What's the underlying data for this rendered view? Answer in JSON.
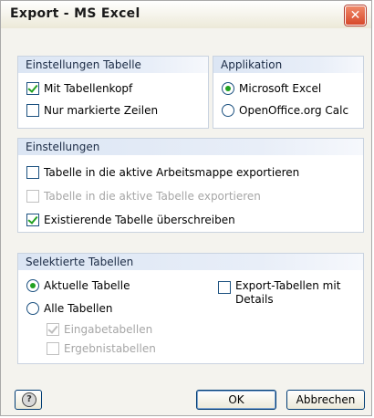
{
  "window": {
    "title": "Export - MS Excel",
    "close_glyph": "✕"
  },
  "settings_table": {
    "header": "Einstellungen Tabelle",
    "with_header": {
      "label": "Mit Tabellenkopf",
      "checked": true
    },
    "selected_rows_only": {
      "label": "Nur markierte Zeilen",
      "checked": false
    }
  },
  "application": {
    "header": "Applikation",
    "options": [
      {
        "label": "Microsoft Excel",
        "selected": true
      },
      {
        "label": "OpenOffice.org Calc",
        "selected": false
      }
    ]
  },
  "settings": {
    "header": "Einstellungen",
    "export_active_workbook": {
      "label": "Tabelle in die aktive Arbeitsmappe exportieren",
      "checked": false,
      "enabled": true
    },
    "export_active_table": {
      "label": "Tabelle in die aktive Tabelle exportieren",
      "checked": false,
      "enabled": false
    },
    "overwrite_existing": {
      "label": "Existierende Tabelle überschreiben",
      "checked": true,
      "enabled": true
    }
  },
  "selected_tables": {
    "header": "Selektierte Tabellen",
    "current_table": {
      "label": "Aktuelle Tabelle",
      "selected": true
    },
    "all_tables": {
      "label": "Alle Tabellen",
      "selected": false
    },
    "input_tables": {
      "label": "Eingabetabellen",
      "checked": true,
      "enabled": false
    },
    "result_tables": {
      "label": "Ergebnistabellen",
      "checked": false,
      "enabled": false
    },
    "export_with_details": {
      "label_line1": "Export-Tabellen mit",
      "label_line2": "Details",
      "checked": false
    }
  },
  "buttons": {
    "ok": "OK",
    "cancel": "Abbrechen",
    "help_icon": "help-icon"
  },
  "colors": {
    "accent_check": "#21a121",
    "header_blue": "#dce6f4",
    "dialog_bg": "#f4f3ee"
  }
}
